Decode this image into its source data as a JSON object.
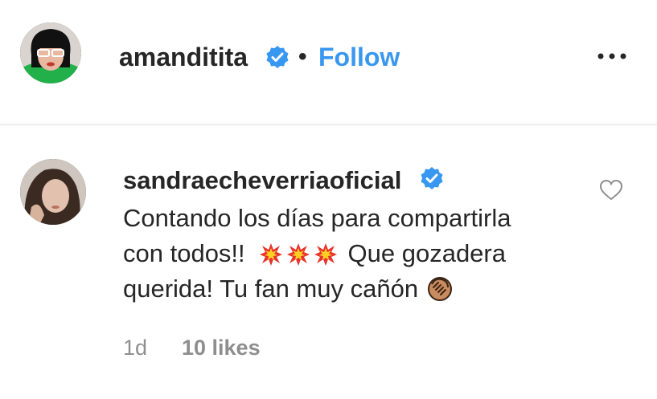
{
  "post_header": {
    "username": "amanditita",
    "separator": "•",
    "follow_label": "Follow",
    "more_icon": "more-options-icon",
    "verified_icon": "verified-badge-icon"
  },
  "comment": {
    "username": "sandraecheverriaoficial",
    "verified_icon": "verified-badge-icon",
    "text_lines": [
      "Contando los días para compartirla",
      "con todos!!",
      "Que gozadera",
      "querida! Tu fan muy cañón"
    ],
    "emojis": [
      "collision-emoji",
      "collision-emoji",
      "collision-emoji",
      "clapping-hands-emoji"
    ],
    "timestamp": "1d",
    "likes": "10 likes",
    "like_icon": "heart-icon"
  },
  "colors": {
    "accent": "#3897f0",
    "text": "#262626",
    "muted": "#8e8e8e",
    "divider": "#efefef"
  }
}
